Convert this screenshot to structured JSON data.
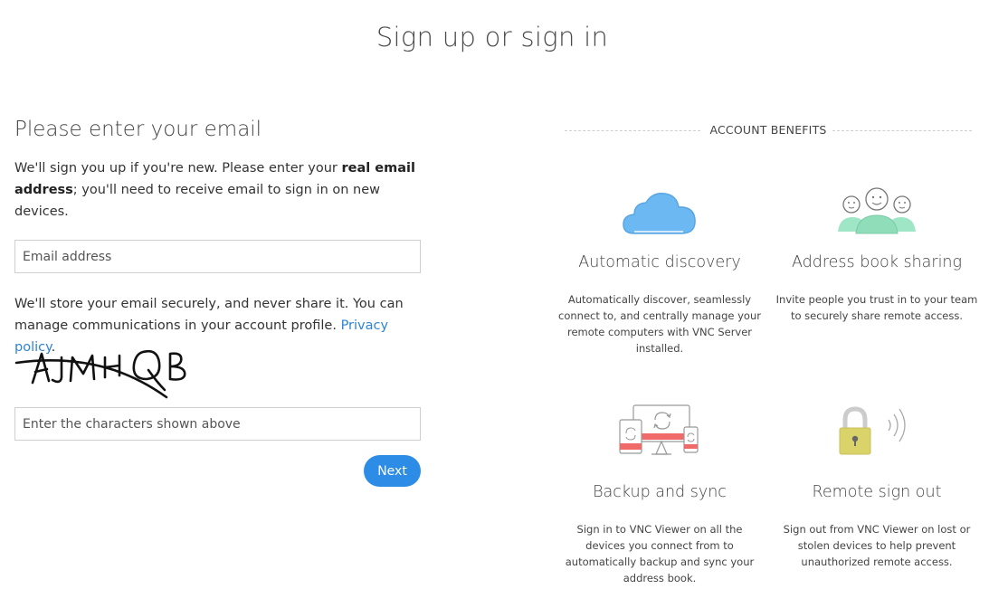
{
  "page": {
    "title": "Sign up or sign in"
  },
  "form": {
    "heading": "Please enter your email",
    "intro_pre": "We'll sign you up if you're new. Please enter your ",
    "intro_bold": "real email address",
    "intro_post": "; you'll need to receive email to sign in on new devices.",
    "email_placeholder": "Email address",
    "store_text": "We'll store your email securely, and never share it. You can manage communications in your account profile. ",
    "privacy_link": "Privacy policy",
    "privacy_after": ".",
    "captcha_text": "AJMHQB",
    "captcha_placeholder": "Enter the characters shown above",
    "next_label": "Next"
  },
  "benefits": {
    "heading": "ACCOUNT BENEFITS",
    "items": [
      {
        "icon": "cloud-icon",
        "title": "Automatic discovery",
        "description": "Automatically discover, seamlessly connect to, and centrally manage your remote computers with VNC Server installed."
      },
      {
        "icon": "people-icon",
        "title": "Address book sharing",
        "description": "Invite people you trust in to your team to securely share remote access."
      },
      {
        "icon": "devices-sync-icon",
        "title": "Backup and sync",
        "description": "Sign in to VNC Viewer on all the devices you connect from to automatically backup and sync your address book."
      },
      {
        "icon": "padlock-signal-icon",
        "title": "Remote sign out",
        "description": "Sign out from VNC Viewer on lost or stolen devices to help prevent unauthorized remote access."
      }
    ]
  },
  "colors": {
    "accent": "#2d8ce6",
    "link": "#2e84d6",
    "cloud": "#6bb8f2",
    "people": "#9ee6c6",
    "sync_red": "#f06a6a",
    "lock": "#d9d36a"
  }
}
